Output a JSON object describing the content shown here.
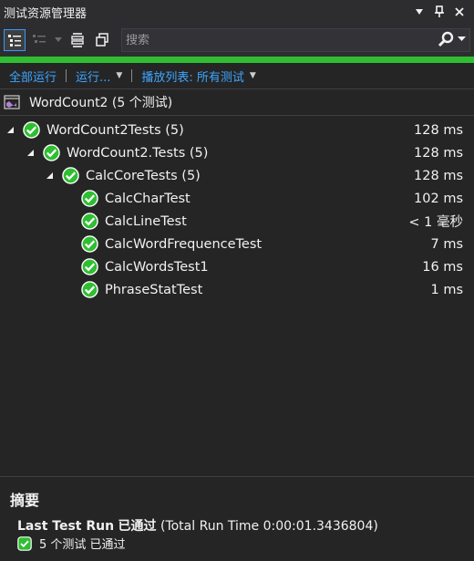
{
  "window": {
    "title": "测试资源管理器"
  },
  "search": {
    "placeholder": "搜索"
  },
  "commands": {
    "run_all": "全部运行",
    "run": "运行...",
    "playlist": "播放列表: 所有测试"
  },
  "project": {
    "label": "WordCount2 (5 个测试)"
  },
  "tree": [
    {
      "label": "WordCount2Tests (5)",
      "duration": "128 ms",
      "status": "passed"
    },
    {
      "label": "WordCount2.Tests (5)",
      "duration": "128 ms",
      "status": "passed"
    },
    {
      "label": "CalcCoreTests (5)",
      "duration": "128 ms",
      "status": "passed"
    },
    {
      "label": "CalcCharTest",
      "duration": "102 ms",
      "status": "passed"
    },
    {
      "label": "CalcLineTest",
      "duration": "< 1 毫秒",
      "status": "passed"
    },
    {
      "label": "CalcWordFrequenceTest",
      "duration": "7 ms",
      "status": "passed"
    },
    {
      "label": "CalcWordsTest1",
      "duration": "16 ms",
      "status": "passed"
    },
    {
      "label": "PhraseStatTest",
      "duration": "1 ms",
      "status": "passed"
    }
  ],
  "summary": {
    "heading": "摘要",
    "last_run_label": "Last Test Run",
    "last_run_status": "已通过",
    "total_time": "(Total Run Time 0:00:01.3436804)",
    "passed_text": "5 个测试 已通过"
  },
  "colors": {
    "accent": "#3ea6ff",
    "pass": "#2fbe32",
    "background": "#252526"
  }
}
